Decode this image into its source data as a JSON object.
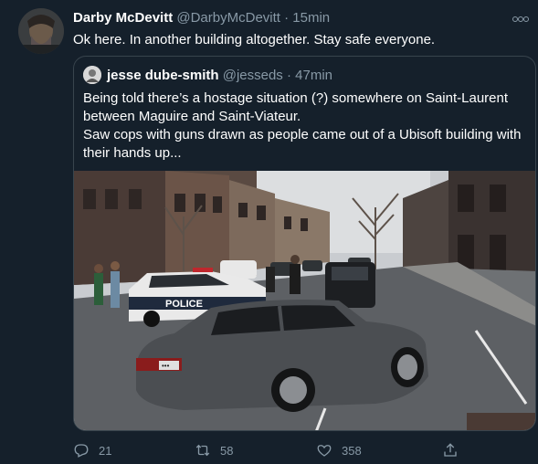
{
  "tweet": {
    "author_name": "Darby McDevitt",
    "handle": "@DarbyMcDevitt",
    "separator": "·",
    "time": "15min",
    "text": "Ok here. In another building altogether. Stay safe everyone."
  },
  "quoted_tweet": {
    "author_name": "jesse dube-smith",
    "handle": "@jesseds",
    "separator": "·",
    "time": "47min",
    "lines": [
      "Being told there’s a hostage situation (?) somewhere on Saint-Laurent",
      "between Maguire and Saint-Viateur.",
      "Saw cops with guns drawn as people came out of a Ubisoft building with",
      "their hands up..."
    ],
    "image": {
      "police_car_text": "POLICE",
      "plate_text": "•••"
    }
  },
  "actions": {
    "reply_count": "21",
    "retweet_count": "58",
    "like_count": "358"
  },
  "icons": [
    "reply-icon",
    "retweet-icon",
    "like-icon",
    "share-icon",
    "more-icon"
  ]
}
